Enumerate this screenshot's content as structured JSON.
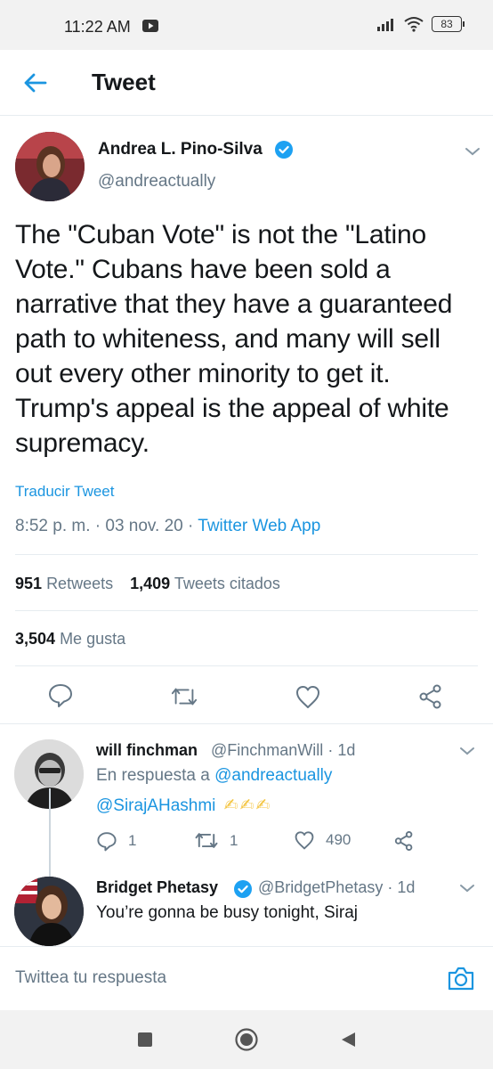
{
  "status_bar": {
    "time": "11:22 AM",
    "battery": "83"
  },
  "header": {
    "title": "Tweet"
  },
  "tweet": {
    "author_name": "Andrea L. Pino-Silva",
    "author_handle": "@andreactually",
    "text": "The \"Cuban Vote\" is not the \"Latino Vote.\" Cubans have been sold a narrative that they have a guaranteed path to whiteness, and many will sell out every other minority to get it. Trump's appeal is the appeal of white supremacy.",
    "translate_label": "Traducir Tweet",
    "time": "8:52 p. m.",
    "date": "03 nov. 20",
    "source": "Twitter Web App",
    "retweets_count": "951",
    "retweets_label": "Retweets",
    "quotes_count": "1,409",
    "quotes_label": "Tweets citados",
    "likes_count": "3,504",
    "likes_label": "Me gusta"
  },
  "replies": [
    {
      "name": "will finchman",
      "handle": "@FinchmanWill",
      "age": "1d",
      "reply_to_prefix": "En respuesta a",
      "reply_to_handle": "@andreactually",
      "mention": "@SirajAHashmi",
      "emoji": "✍✍✍",
      "reply_count": "1",
      "retweet_count": "1",
      "like_count": "490"
    },
    {
      "name": "Bridget Phetasy",
      "handle": "@BridgetPhetasy",
      "age": "1d",
      "text": "You’re gonna be busy tonight, Siraj"
    }
  ],
  "compose": {
    "placeholder": "Twittea tu respuesta"
  },
  "colors": {
    "accent": "#1b95e0",
    "secondary_text": "#657786",
    "divider": "#e6ecf0"
  }
}
